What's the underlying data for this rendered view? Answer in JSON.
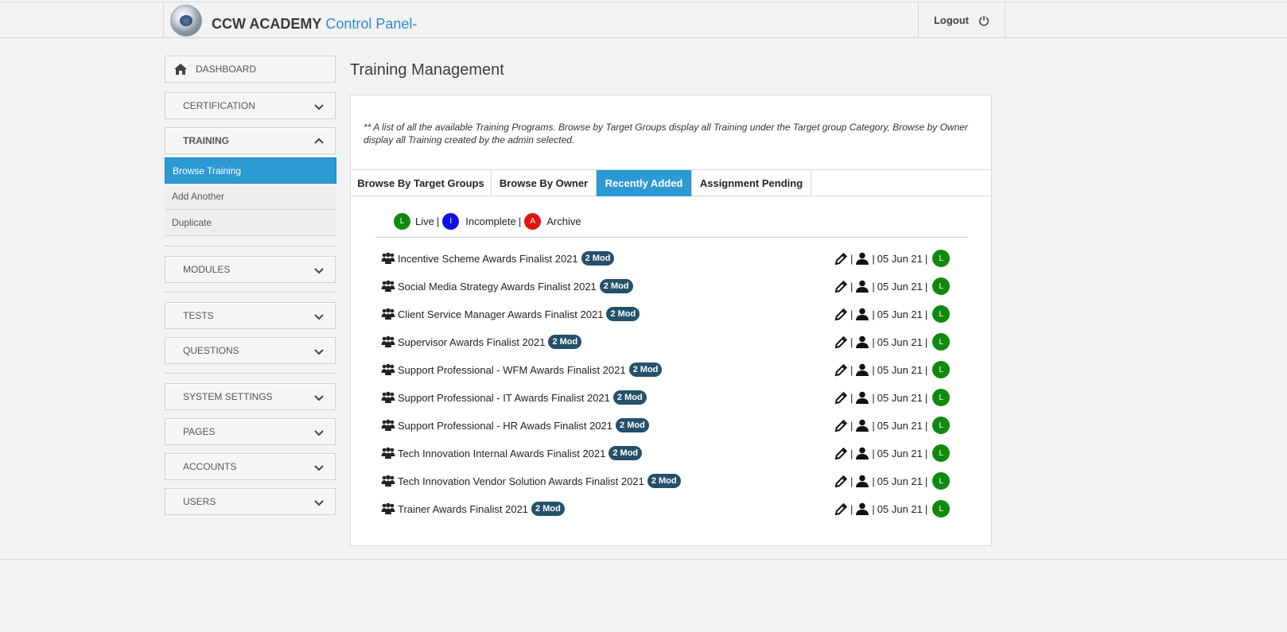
{
  "header": {
    "brand_main": "CCW ACADEMY",
    "brand_sub": "Control Panel-",
    "logout_label": "Logout",
    "logout_icon": "power-icon"
  },
  "sidebar": {
    "dashboard_label": "DASHBOARD",
    "certification_label": "CERTIFICATION",
    "training_label": "TRAINING",
    "training_sub": [
      "Browse Training",
      "Add Another",
      "Duplicate"
    ],
    "modules_label": "MODULES",
    "tests_label": "TESTS",
    "questions_label": "QUESTIONS",
    "system_settings_label": "SYSTEM SETTINGS",
    "pages_label": "PAGES",
    "accounts_label": "ACCOUNTS",
    "users_label": "USERS",
    "active_color": "#2c9ad3"
  },
  "main": {
    "title": "Training Management",
    "description": "** A list of all the available Training Programs. Browse by Target Groups display all Training under the Target group Category, Browse by Owner display all Training created by the admin selected.",
    "tabs": [
      "Browse By Target Groups",
      "Browse By Owner",
      "Recently Added",
      "Assignment Pending"
    ],
    "active_tab": "Recently Added",
    "legend": {
      "live_letter": "L",
      "live_label": "Live",
      "incomplete_letter": "I",
      "incomplete_label": "Incomplete",
      "archive_letter": "A",
      "archive_label": "Archive",
      "sep": "|",
      "colors": {
        "live": "#0e8a0e",
        "incomplete": "#1010e6",
        "archive": "#e01414"
      }
    },
    "rows": [
      {
        "title": "Incentive Scheme Awards Finalist 2021",
        "badge": "2 Mod",
        "date": "05 Jun 21",
        "status": "L"
      },
      {
        "title": "Social Media Strategy Awards Finalist 2021",
        "badge": "2 Mod",
        "date": "05 Jun 21",
        "status": "L"
      },
      {
        "title": "Client Service Manager Awards Finalist 2021",
        "badge": "2 Mod",
        "date": "05 Jun 21",
        "status": "L"
      },
      {
        "title": "Supervisor Awards Finalist 2021",
        "badge": "2 Mod",
        "date": "05 Jun 21",
        "status": "L"
      },
      {
        "title": "Support Professional - WFM Awards Finalist 2021",
        "badge": "2 Mod",
        "date": "05 Jun 21",
        "status": "L"
      },
      {
        "title": "Support Professional - IT Awards Finalist 2021",
        "badge": "2 Mod",
        "date": "05 Jun 21",
        "status": "L"
      },
      {
        "title": "Support Professional - HR Awads Finalist 2021",
        "badge": "2 Mod",
        "date": "05 Jun 21",
        "status": "L"
      },
      {
        "title": "Tech Innovation Internal Awards Finalist 2021",
        "badge": "2 Mod",
        "date": "05 Jun 21",
        "status": "L"
      },
      {
        "title": "Tech Innovation Vendor Solution Awards Finalist 2021",
        "badge": "2 Mod",
        "date": "05 Jun 21",
        "status": "L"
      },
      {
        "title": "Trainer Awards Finalist 2021",
        "badge": "2 Mod",
        "date": "05 Jun 21",
        "status": "L"
      }
    ],
    "row_sep": "|",
    "row_icons": [
      "group-icon",
      "edit-icon",
      "user-icon"
    ]
  }
}
